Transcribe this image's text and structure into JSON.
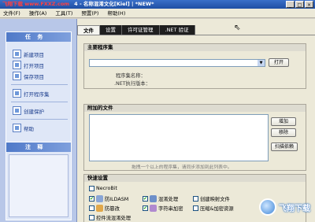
{
  "window": {
    "site_tag": "飞翔下载 www.FXXZ.com",
    "title": "4 - 名称混淆文化[Kiel] | *NEW*",
    "minimize": "_",
    "maximize": "□",
    "close": "×"
  },
  "menu": [
    "文件(F)",
    "操作(A)",
    "工具(T)",
    "预置(P)",
    "帮助(H)"
  ],
  "sidebar": {
    "tasks_title": "任 务",
    "tasks": [
      "新建项目",
      "打开项目",
      "保存项目",
      "打开程序集",
      "创建保护",
      "帮助"
    ],
    "notes_title": "注 释"
  },
  "tabs": [
    "文件",
    "设置",
    "许可证管理",
    ".NET 验证"
  ],
  "main_assembly": {
    "title": "主要程序集",
    "open_button": "打开",
    "name_label": "程序集名称：",
    "version_label": ".NET执行版本："
  },
  "attached_files": {
    "title": "附加的文件",
    "buttons": [
      "增加",
      "移除",
      "扫描依赖"
    ],
    "hint": "拖拽一个以上的程序集，请同步添加到此列表中。"
  },
  "quick_settings": {
    "title": "快速设置",
    "options": [
      {
        "label": "NecroBit",
        "checked": false
      },
      {
        "label": "防ILDASM",
        "checked": true
      },
      {
        "label": "混淆处理",
        "checked": true
      },
      {
        "label": "创建映射文件",
        "checked": false
      },
      {
        "label": "防篡改",
        "checked": false
      },
      {
        "label": "字符串加密",
        "checked": true
      },
      {
        "label": "压缩&加密资源",
        "checked": false
      },
      {
        "label": "控件流混淆处理",
        "checked": false
      }
    ],
    "check_mark": "✔"
  },
  "watermark": "飞翔下载",
  "colors": {
    "titlebar": "#1e4ea3",
    "sidebar": "#b8c7e8",
    "panel_head": "#4f79c8",
    "tab_active": "#f5f5f0",
    "tab_inactive": "#1f1f1f"
  }
}
